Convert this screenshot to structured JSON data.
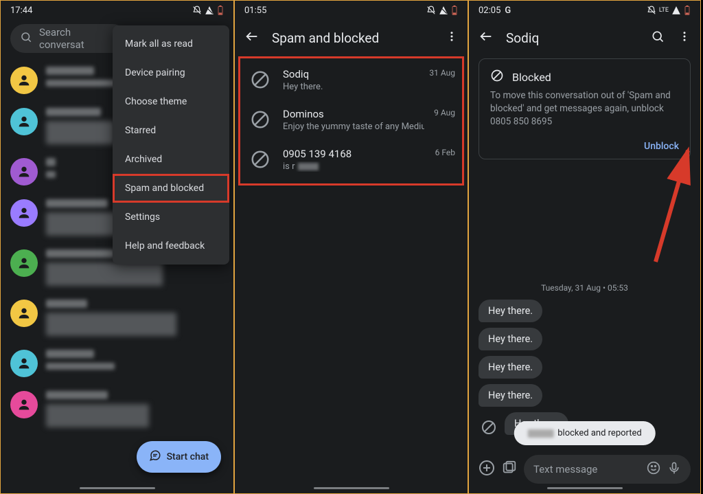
{
  "panel1": {
    "time": "17:44",
    "search_placeholder": "Search conversat",
    "menu": {
      "items": [
        "Mark all as read",
        "Device pairing",
        "Choose theme",
        "Starred",
        "Archived",
        "Spam and blocked",
        "Settings",
        "Help and feedback"
      ],
      "highlight_index": 5
    },
    "avatars": [
      "#f2c744",
      "#4fc3d7",
      "#a05bd1",
      "#9a7cff",
      "#4caf50",
      "#f2c744",
      "#4fc3d7",
      "#e64a9b"
    ],
    "fab_label": "Start chat"
  },
  "panel2": {
    "time": "01:55",
    "title": "Spam and blocked",
    "items": [
      {
        "name": "Sodiq",
        "preview": "Hey there.",
        "date": "31 Aug"
      },
      {
        "name": "Dominos",
        "preview": "Enjoy the yummy taste of any Medium …",
        "date": "9 Aug"
      },
      {
        "name": "0905 139 4168",
        "preview": "is r",
        "date": "6 Feb",
        "blurred_tail": true
      }
    ]
  },
  "panel3": {
    "time": "02:05",
    "indicator": "G",
    "title": "Sodiq",
    "blocked_card": {
      "title": "Blocked",
      "body": "To move this conversation out of 'Spam and blocked' and get messages again, unblock 0805 850 8695",
      "action": "Unblock"
    },
    "date_separator": "Tuesday, 31 Aug • 05:53",
    "messages": [
      "Hey there.",
      "Hey there.",
      "Hey there.",
      "Hey there.",
      "Hey there."
    ],
    "toast": "blocked and reported",
    "composer_placeholder": "Text message"
  },
  "status_icons": {
    "lte_label": "LTE"
  }
}
